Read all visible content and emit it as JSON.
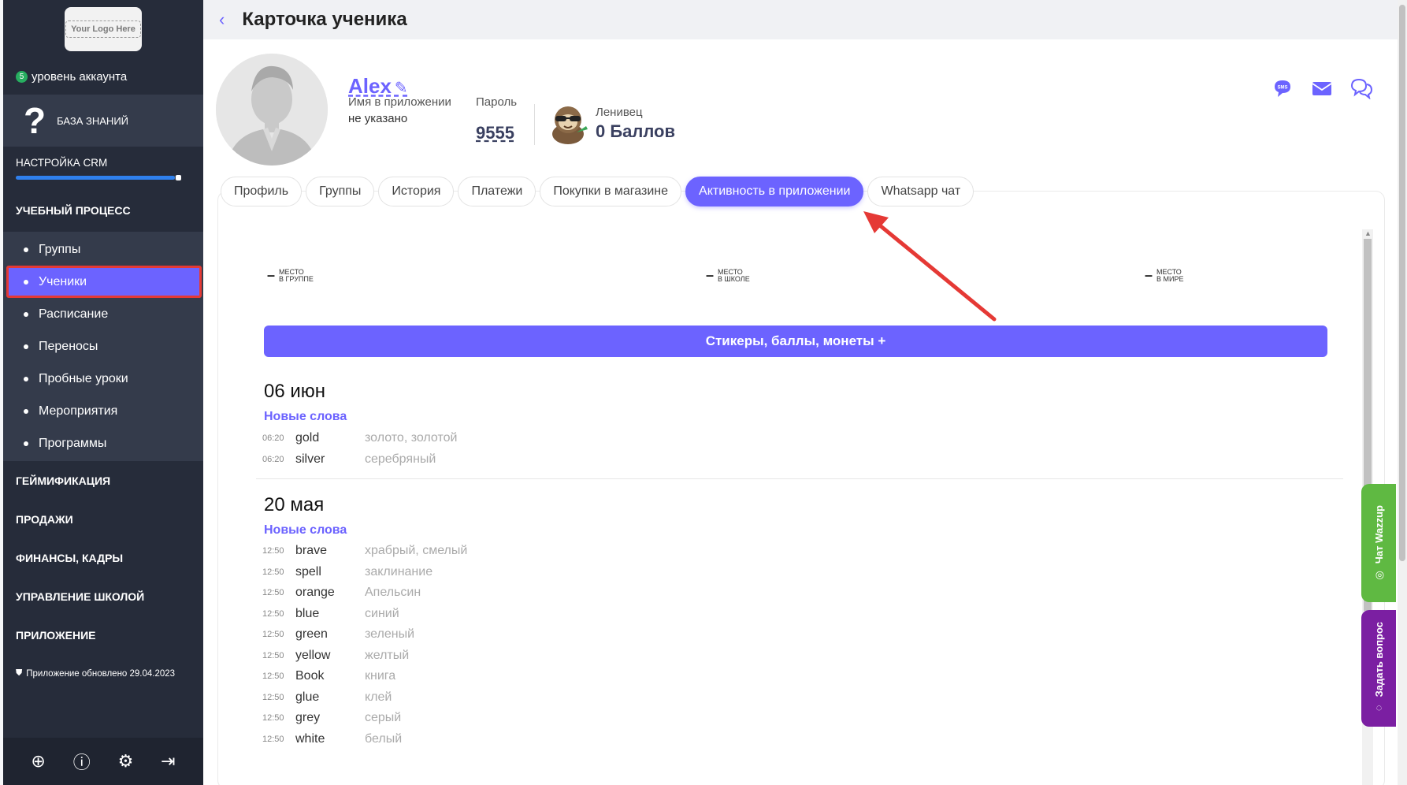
{
  "sidebar": {
    "logo_text": "Your Logo Here",
    "account_level_badge": "5",
    "account_level_label": "уровень аккаунта",
    "knowledge_base": "БАЗА ЗНАНИЙ",
    "crm_setup": "НАСТРОЙКА CRM",
    "crm_progress": 0.96,
    "section_learning": "УЧЕБНЫЙ ПРОЦЕСС",
    "learning_items": [
      "Группы",
      "Ученики",
      "Расписание",
      "Переносы",
      "Пробные уроки",
      "Мероприятия",
      "Программы"
    ],
    "sections": [
      "ГЕЙМИФИКАЦИЯ",
      "ПРОДАЖИ",
      "ФИНАНСЫ, КАДРЫ",
      "УПРАВЛЕНИЕ ШКОЛОЙ",
      "ПРИЛОЖЕНИЕ"
    ],
    "updated_text": "Приложение обновлено 29.04.2023",
    "bottom_icons": [
      "support-icon",
      "help-icon",
      "settings-icon",
      "logout-icon"
    ]
  },
  "header": {
    "back_icon": "‹",
    "title": "Карточка ученика"
  },
  "student": {
    "name": "Alex",
    "app_name_label": "Имя в приложении",
    "app_name_value": "не указано",
    "password_label": "Пароль",
    "password_value": "9555",
    "rank_label": "Ленивец",
    "points": "0 Баллов"
  },
  "tabs": [
    "Профиль",
    "Группы",
    "История",
    "Платежи",
    "Покупки в магазине",
    "Активность в приложении",
    "Whatsapp чат"
  ],
  "active_tab": "Активность в приложении",
  "places": [
    {
      "value": "–",
      "line1": "МЕСТО",
      "line2": "В ГРУППЕ"
    },
    {
      "value": "–",
      "line1": "МЕСТО",
      "line2": "В ШКОЛЕ"
    },
    {
      "value": "–",
      "line1": "МЕСТО",
      "line2": "В МИРЕ"
    }
  ],
  "rewards_button": "Стикеры, баллы, монеты +",
  "activity": [
    {
      "date": "06 июн",
      "section": "Новые слова",
      "words": [
        {
          "time": "06:20",
          "word": "gold",
          "translation": "золото, золотой"
        },
        {
          "time": "06:20",
          "word": "silver",
          "translation": "серебряный"
        }
      ]
    },
    {
      "date": "20 мая",
      "section": "Новые слова",
      "words": [
        {
          "time": "12:50",
          "word": "brave",
          "translation": "храбрый, смелый"
        },
        {
          "time": "12:50",
          "word": "spell",
          "translation": "заклинание"
        },
        {
          "time": "12:50",
          "word": "orange",
          "translation": "Апельсин"
        },
        {
          "time": "12:50",
          "word": "blue",
          "translation": "синий"
        },
        {
          "time": "12:50",
          "word": "green",
          "translation": "зеленый"
        },
        {
          "time": "12:50",
          "word": "yellow",
          "translation": "желтый"
        },
        {
          "time": "12:50",
          "word": "Book",
          "translation": "книга"
        },
        {
          "time": "12:50",
          "word": "glue",
          "translation": "клей"
        },
        {
          "time": "12:50",
          "word": "grey",
          "translation": "серый"
        },
        {
          "time": "12:50",
          "word": "white",
          "translation": "белый"
        }
      ]
    }
  ],
  "widgets": {
    "wazzup": "Чат Wazzup",
    "ask": "Задать вопрос"
  },
  "colors": {
    "accent": "#6c63ff",
    "sidebar_bg": "#262c3a",
    "highlight_border": "#e53935",
    "wazzup_green": "#5fb942",
    "ask_purple": "#7b1fa2"
  }
}
